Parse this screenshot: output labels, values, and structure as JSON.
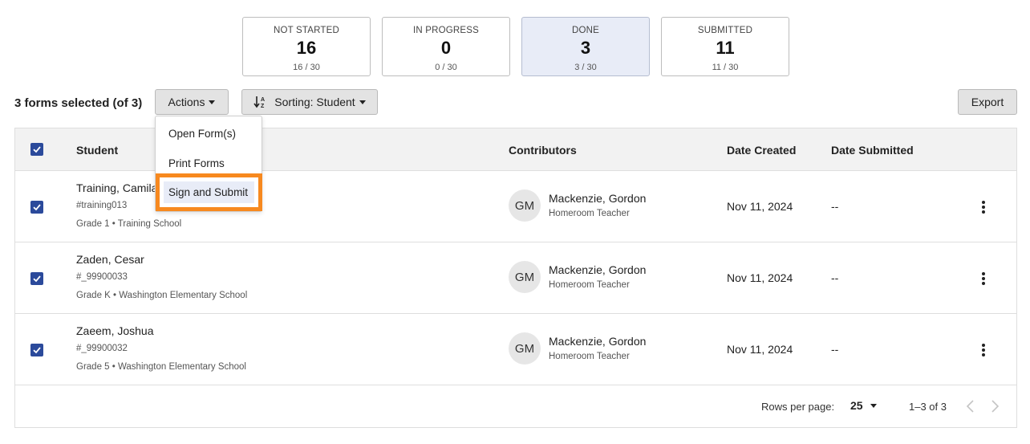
{
  "status_cards": [
    {
      "label": "NOT STARTED",
      "count": "16",
      "ratio": "16 / 30"
    },
    {
      "label": "IN PROGRESS",
      "count": "0",
      "ratio": "0 / 30"
    },
    {
      "label": "DONE",
      "count": "3",
      "ratio": "3 / 30"
    },
    {
      "label": "SUBMITTED",
      "count": "11",
      "ratio": "11 / 30"
    }
  ],
  "toolbar": {
    "selected_text": "3 forms selected (of 3)",
    "actions_label": "Actions",
    "sort_label": "Sorting: Student",
    "export_label": "Export"
  },
  "actions_menu": {
    "items": [
      "Open Form(s)",
      "Print Forms",
      "Sign and Submit"
    ],
    "highlight_color": "#f7891f"
  },
  "table": {
    "headers": {
      "student": "Student",
      "contributors": "Contributors",
      "date_created": "Date Created",
      "date_submitted": "Date Submitted"
    },
    "rows": [
      {
        "name": "Training, Camila",
        "id": "#training013",
        "grade": "Grade 1 • Training School",
        "initials": "GM",
        "contributor": "Mackenzie, Gordon",
        "role": "Homeroom Teacher",
        "created": "Nov 11, 2024",
        "submitted": "--"
      },
      {
        "name": "Zaden, Cesar",
        "id": "#_99900033",
        "grade": "Grade K • Washington Elementary School",
        "initials": "GM",
        "contributor": "Mackenzie, Gordon",
        "role": "Homeroom Teacher",
        "created": "Nov 11, 2024",
        "submitted": "--"
      },
      {
        "name": "Zaeem, Joshua",
        "id": "#_99900032",
        "grade": "Grade 5 • Washington Elementary School",
        "initials": "GM",
        "contributor": "Mackenzie, Gordon",
        "role": "Homeroom Teacher",
        "created": "Nov 11, 2024",
        "submitted": "--"
      }
    ],
    "footer": {
      "rows_per_page_label": "Rows per page:",
      "rows_per_page": "25",
      "range": "1–3 of 3"
    }
  },
  "colors": {
    "checkbox": "#2b4a9b",
    "selected_card": "#e8ecf7"
  }
}
